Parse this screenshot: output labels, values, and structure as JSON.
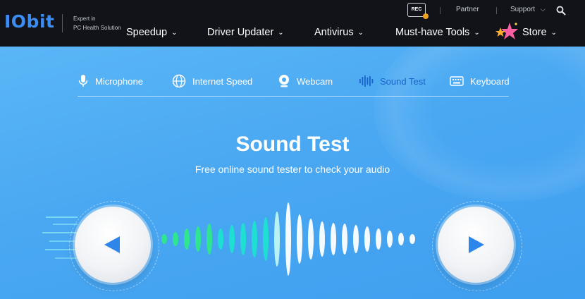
{
  "brand": {
    "logo": "IObit",
    "tagline_1": "Expert in",
    "tagline_2": "PC Health Solution"
  },
  "utility": {
    "partner": "Partner",
    "support": "Support",
    "rec_label": "REC"
  },
  "nav": [
    {
      "label": "Speedup",
      "chevron": "⌄"
    },
    {
      "label": "Driver Updater",
      "chevron": "⌄"
    },
    {
      "label": "Antivirus",
      "chevron": "⌄"
    },
    {
      "label": "Must-have Tools",
      "chevron": "⌄"
    },
    {
      "label": "Store",
      "chevron": "⌄"
    }
  ],
  "tabs": [
    {
      "label": "Microphone",
      "icon": "microphone-icon"
    },
    {
      "label": "Internet Speed",
      "icon": "globe-icon"
    },
    {
      "label": "Webcam",
      "icon": "webcam-icon"
    },
    {
      "label": "Sound Test",
      "icon": "sound-wave-icon",
      "active": true
    },
    {
      "label": "Keyboard",
      "icon": "keyboard-icon"
    }
  ],
  "hero": {
    "title": "Sound Test",
    "subtitle": "Free online sound tester to check your audio"
  },
  "colors": {
    "nav_bg": "#111318",
    "hero_bg": "#4aa8f2",
    "active_tab": "#1763c9",
    "play_arrow": "#2f86ea",
    "wave_green": "#2fe88a",
    "wave_cyan": "#1ee0d0",
    "wave_white": "#ffffff"
  }
}
